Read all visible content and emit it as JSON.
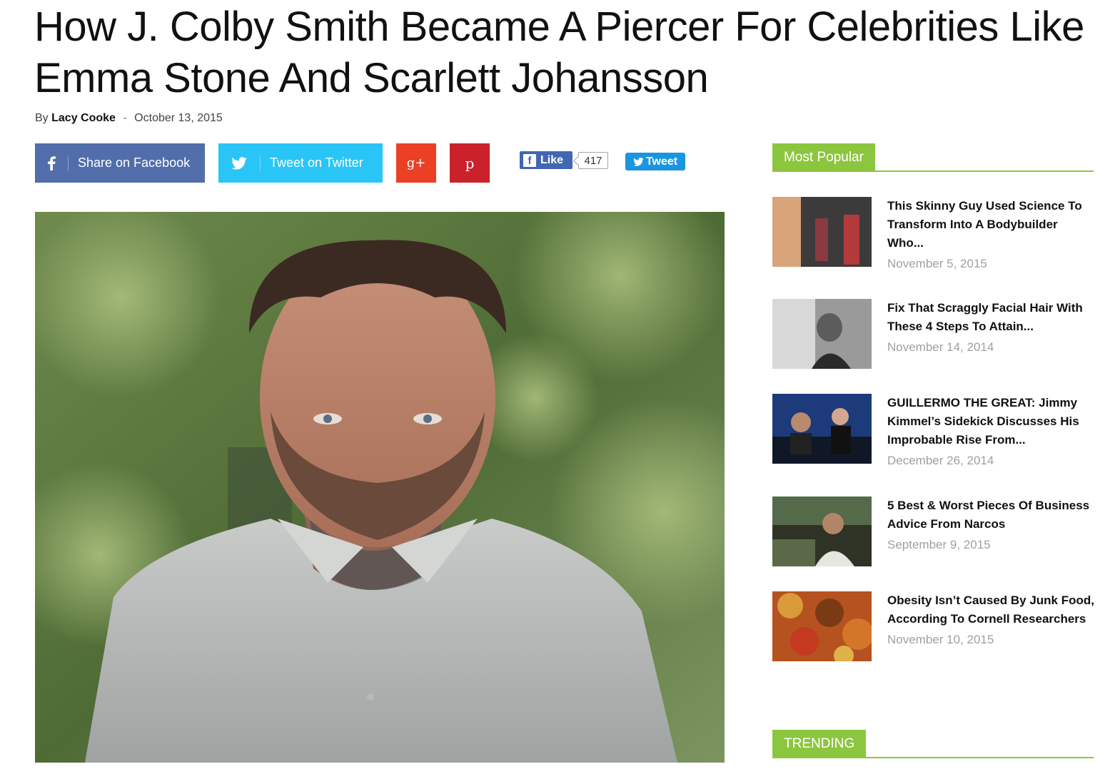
{
  "article": {
    "title": "How J. Colby Smith Became A Piercer For Celebrities Like Emma Stone And Scarlett Johansson",
    "by": "By",
    "author": "Lacy Cooke",
    "date": "October 13, 2015"
  },
  "share": {
    "facebook": "Share on Facebook",
    "twitter": "Tweet on Twitter",
    "gplus_icon": "g+",
    "pinterest_icon": "p",
    "like_label": "Like",
    "like_count": "417",
    "tweet_label": "Tweet"
  },
  "sidebar": {
    "most_popular": "Most Popular",
    "trending": "TRENDING",
    "items": [
      {
        "title": "This Skinny Guy Used Science To Transform Into A Bodybuilder Who...",
        "date": "November 5, 2015"
      },
      {
        "title": "Fix That Scraggly Facial Hair With These 4 Steps To Attain...",
        "date": "November 14, 2014"
      },
      {
        "title": "GUILLERMO THE GREAT: Jimmy Kimmel’s Sidekick Discusses His Improbable Rise From...",
        "date": "December 26, 2014"
      },
      {
        "title": "5 Best & Worst Pieces Of Business Advice From Narcos",
        "date": "September 9, 2015"
      },
      {
        "title": "Obesity Isn’t Caused By Junk Food, According To Cornell Researchers",
        "date": "November 10, 2015"
      }
    ]
  },
  "colors": {
    "facebook": "#516eab",
    "twitter": "#29c5f6",
    "gplus": "#eb4026",
    "pinterest": "#ca212a",
    "accent_green": "#8cc63f"
  },
  "icons": [
    "facebook-icon",
    "twitter-icon",
    "google-plus-icon",
    "pinterest-icon"
  ]
}
